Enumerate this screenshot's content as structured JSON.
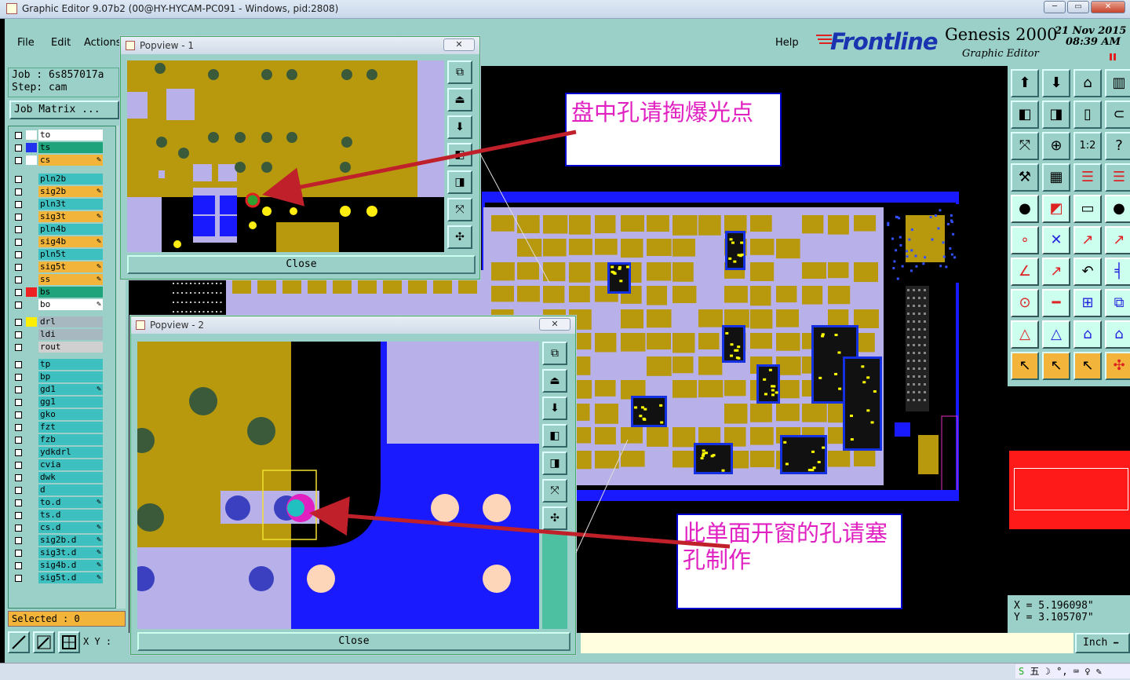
{
  "window": {
    "title": "Graphic Editor 9.07b2 (00@HY-HYCAM-PC091 - Windows, pid:2808)"
  },
  "menu": {
    "file": "File",
    "edit": "Edit",
    "actions": "Actions",
    "help": "Help"
  },
  "brand": {
    "logo": "Frontline",
    "product": "Genesis 2000",
    "subtitle": "Graphic Editor",
    "date": "21 Nov 2015",
    "time": "08:39 AM"
  },
  "job": {
    "job_label": "Job : 6s857017a",
    "step_label": "Step: cam",
    "matrix_button": "Job Matrix ..."
  },
  "layers": [
    {
      "name": "to",
      "color": "#ffffff",
      "swatch": "#ffffff",
      "edit": false
    },
    {
      "name": "ts",
      "color": "#1fa37a",
      "swatch": "#2233ee",
      "edit": false
    },
    {
      "name": "cs",
      "color": "#f2b43a",
      "swatch": "#ffffff",
      "edit": true
    },
    {
      "name": "pln2b",
      "color": "#3fc0c0",
      "swatch": "",
      "edit": false
    },
    {
      "name": "sig2b",
      "color": "#f2b43a",
      "swatch": "",
      "edit": true
    },
    {
      "name": "pln3t",
      "color": "#3fc0c0",
      "swatch": "",
      "edit": false
    },
    {
      "name": "sig3t",
      "color": "#f2b43a",
      "swatch": "",
      "edit": true
    },
    {
      "name": "pln4b",
      "color": "#3fc0c0",
      "swatch": "",
      "edit": false
    },
    {
      "name": "sig4b",
      "color": "#f2b43a",
      "swatch": "",
      "edit": true
    },
    {
      "name": "pln5t",
      "color": "#3fc0c0",
      "swatch": "",
      "edit": false
    },
    {
      "name": "sig5t",
      "color": "#f2b43a",
      "swatch": "",
      "edit": true
    },
    {
      "name": "ss",
      "color": "#f2b43a",
      "swatch": "",
      "edit": true
    },
    {
      "name": "bs",
      "color": "#1fa37a",
      "swatch": "#ee2222",
      "edit": false
    },
    {
      "name": "bo",
      "color": "#ffffff",
      "swatch": "",
      "edit": true
    },
    {
      "name": "drl",
      "color": "#a8b8c0",
      "swatch": "#ffee00",
      "edit": false
    },
    {
      "name": "ldi",
      "color": "#a8b8c0",
      "swatch": "",
      "edit": false
    },
    {
      "name": "rout",
      "color": "#d0d0d0",
      "swatch": "",
      "edit": false
    },
    {
      "name": "tp",
      "color": "#3fc0c0",
      "swatch": "",
      "edit": false
    },
    {
      "name": "bp",
      "color": "#3fc0c0",
      "swatch": "",
      "edit": false
    },
    {
      "name": "gd1",
      "color": "#3fc0c0",
      "swatch": "",
      "edit": true
    },
    {
      "name": "gg1",
      "color": "#3fc0c0",
      "swatch": "",
      "edit": false
    },
    {
      "name": "gko",
      "color": "#3fc0c0",
      "swatch": "",
      "edit": false
    },
    {
      "name": "fzt",
      "color": "#3fc0c0",
      "swatch": "",
      "edit": false
    },
    {
      "name": "fzb",
      "color": "#3fc0c0",
      "swatch": "",
      "edit": false
    },
    {
      "name": "ydkdrl",
      "color": "#3fc0c0",
      "swatch": "",
      "edit": false
    },
    {
      "name": "cvia",
      "color": "#3fc0c0",
      "swatch": "",
      "edit": false
    },
    {
      "name": "dwk",
      "color": "#3fc0c0",
      "swatch": "",
      "edit": false
    },
    {
      "name": "d",
      "color": "#3fc0c0",
      "swatch": "",
      "edit": false
    },
    {
      "name": "to.d",
      "color": "#3fc0c0",
      "swatch": "",
      "edit": true
    },
    {
      "name": "ts.d",
      "color": "#3fc0c0",
      "swatch": "",
      "edit": false
    },
    {
      "name": "cs.d",
      "color": "#3fc0c0",
      "swatch": "",
      "edit": true
    },
    {
      "name": "sig2b.d",
      "color": "#3fc0c0",
      "swatch": "",
      "edit": true
    },
    {
      "name": "sig3t.d",
      "color": "#3fc0c0",
      "swatch": "",
      "edit": true
    },
    {
      "name": "sig4b.d",
      "color": "#3fc0c0",
      "swatch": "",
      "edit": true
    },
    {
      "name": "sig5t.d",
      "color": "#3fc0c0",
      "swatch": "",
      "edit": true
    }
  ],
  "status": {
    "selected": "Selected : 0",
    "xy_label": "X Y :",
    "x_coord": "X = 5.196098\"",
    "y_coord": "Y = 3.105707\"",
    "units": "Inch"
  },
  "popview1": {
    "title": "Popview - 1",
    "close": "Close"
  },
  "popview2": {
    "title": "Popview - 2",
    "close": "Close"
  },
  "annotations": {
    "note1": "盘中孔请掏爆光点",
    "note2": "此单面开窗的孔请塞孔制作"
  },
  "tool_icons": [
    "pan-up-icon",
    "pan-down-icon",
    "home-icon",
    "window-icon",
    "pan-left-icon",
    "pan-right-icon",
    "zoom-icon",
    "snap-icon",
    "fit-icon",
    "center-icon",
    "scale-1-2-icon",
    "help-icon",
    "wrench-icon",
    "grid-icon",
    "layers-icon",
    "layers2-icon",
    "pad-icon",
    "drill-icon",
    "ruler-icon",
    "dot-icon",
    "node-icon",
    "cross-icon",
    "line-icon",
    "line2-icon",
    "angle-icon",
    "draw-icon",
    "arc-icon",
    "ff-icon",
    "attach-icon",
    "minus-icon",
    "box-icon",
    "multi-icon",
    "triangle-icon",
    "triangle2-icon",
    "arch-icon",
    "arch2-icon",
    "select-icon",
    "select2-icon",
    "select3-icon",
    "node-move-icon"
  ]
}
